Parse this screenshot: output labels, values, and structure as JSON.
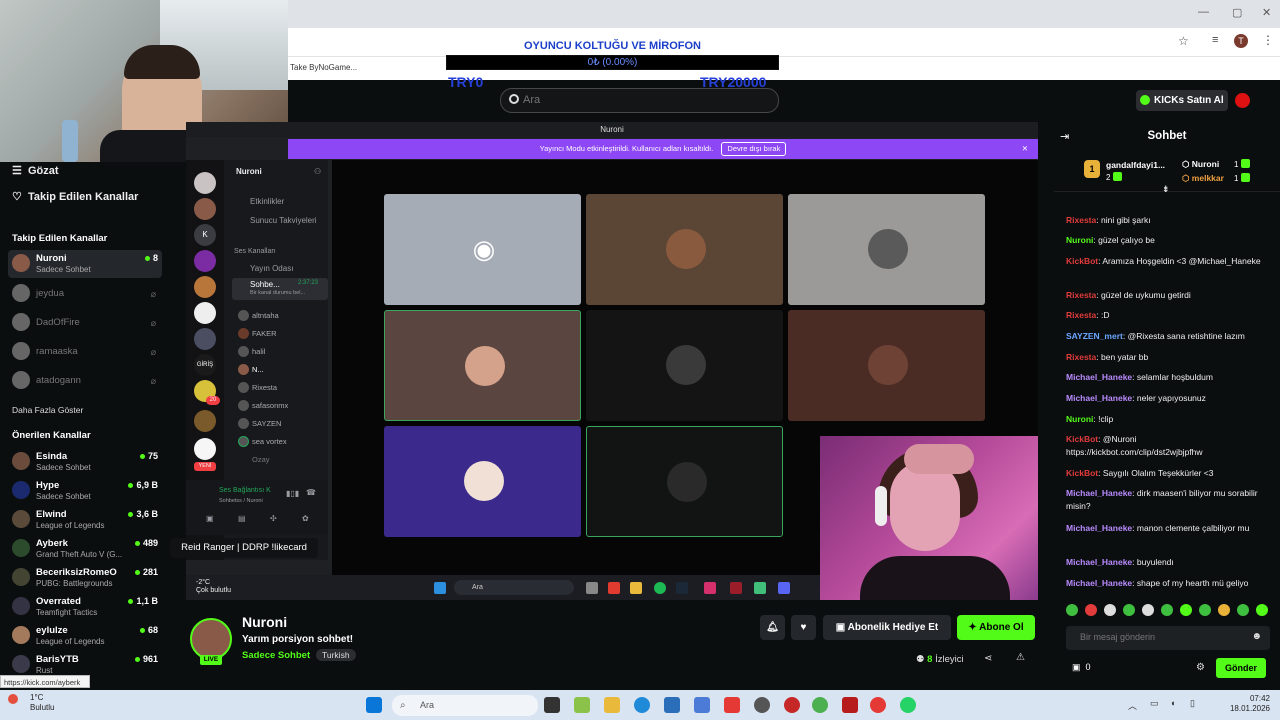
{
  "goal": {
    "title": "OYUNCU KOLTUĞU VE MİROFON",
    "progress_text": "0₺ (0.00%)",
    "progress_fraction": 0.0,
    "min_label": "TRY0",
    "max_label": "TRY20000"
  },
  "browser": {
    "bookmark": "Take ByNoGame...",
    "profile_initial": "T"
  },
  "header": {
    "search_placeholder": "Ara",
    "kicks_button": "KICKs Satın Al"
  },
  "sidebar": {
    "nav": [
      {
        "label": "Gözat"
      },
      {
        "label": "Takip Edilen Kanallar"
      }
    ],
    "followed_title": "Takip Edilen Kanallar",
    "followed": [
      {
        "name": "Nuroni",
        "category": "Sadece Sohbet",
        "count": "8",
        "live": true
      },
      {
        "name": "jeydua",
        "live": false
      },
      {
        "name": "DadOfFire",
        "live": false
      },
      {
        "name": "ramaaska",
        "live": false
      },
      {
        "name": "atadogann",
        "live": false
      }
    ],
    "show_more": "Daha Fazla Göster",
    "recommended_title": "Önerilen Kanallar",
    "recommended": [
      {
        "name": "Esinda",
        "category": "Sadece Sohbet",
        "count": "75"
      },
      {
        "name": "Hype",
        "category": "Sadece Sohbet",
        "count": "6,9 B"
      },
      {
        "name": "Elwind",
        "category": "League of Legends",
        "count": "3,6 B"
      },
      {
        "name": "Ayberk",
        "category": "Grand Theft Auto V (G...",
        "count": "489"
      },
      {
        "name": "BeceriksizRomeO",
        "category": "PUBG: Battlegrounds",
        "count": "281"
      },
      {
        "name": "Overrated",
        "category": "Teamfight Tactics",
        "count": "1,1 B"
      },
      {
        "name": "eylulze",
        "category": "League of Legends",
        "count": "68"
      },
      {
        "name": "BarisYTB",
        "category": "Rust",
        "count": "961"
      }
    ]
  },
  "discord": {
    "window_title": "Nuroni",
    "banner_text": "Yayıncı Modu etkinleştirildi. Kullanıcı adları kısaltıldı.",
    "banner_button": "Devre dışı bırak",
    "server_name": "Nuroni",
    "server_initial": "K",
    "server_giris": "GİRİŞ",
    "server_badge": "20",
    "server_new": "YENİ",
    "channel_items": [
      "Etkinlikler",
      "Sunucu Takviyeleri"
    ],
    "voice_category": "Ses Kanalları",
    "stream_room": "Yayın Odası",
    "active_channel": "Sohbe...",
    "active_time": "2:37:23",
    "active_sub": "Bir kanal durumu bel...",
    "voice_users": [
      "altntaha",
      "FAKER",
      "halil",
      "N...",
      "Rixesta",
      "safasonmx",
      "SAYZEN",
      "sea vortex",
      "Ozay"
    ],
    "voice_status": "Ses Bağlantısı K",
    "voice_sub": "Sohbetss / Nuroni",
    "tooltip": "Reid Ranger | DDRP !likecard",
    "taskbar_search": "Ara",
    "taskbar_weather": "-2°C",
    "taskbar_weather_sub": "Çok bulutlu"
  },
  "chat": {
    "title": "Sohbet",
    "pinned": [
      {
        "name": "gandalfdayi1...",
        "count": "2"
      },
      {
        "name": "Nuroni",
        "count": "1"
      },
      {
        "name": "melkkar",
        "count": "1"
      }
    ],
    "messages": [
      {
        "user": "Rixesta",
        "color": "#e23b3b",
        "text": "nini gibi şarkı"
      },
      {
        "user": "Nuroni",
        "color": "#53fc18",
        "text": "güzel çalıyo be"
      },
      {
        "user": "KickBot",
        "color": "#e23b3b",
        "text": "Aramıza Hoşgeldin <3 @Michael_Haneke"
      },
      {
        "user": "Rixesta",
        "color": "#e23b3b",
        "text": "güzel de uykumu getirdi"
      },
      {
        "user": "Rixesta",
        "color": "#e23b3b",
        "text": ":D"
      },
      {
        "user": "SAYZEN_mert",
        "color": "#6aa6ff",
        "text": "@Rixesta sana retishtine lazım"
      },
      {
        "user": "Rixesta",
        "color": "#e23b3b",
        "text": "ben yatar bb"
      },
      {
        "user": "Michael_Haneke",
        "color": "#b98bff",
        "text": "selamlar hoşbuldum"
      },
      {
        "user": "Michael_Haneke",
        "color": "#b98bff",
        "text": "neler yapıyosunuz"
      },
      {
        "user": "Nuroni",
        "color": "#53fc18",
        "text": "!clip"
      },
      {
        "user": "KickBot",
        "color": "#e23b3b",
        "text": "@Nuroni https://kickbot.com/clip/dst2wjbjpfhw"
      },
      {
        "user": "KickBot",
        "color": "#e23b3b",
        "text": "Saygılı Olalım Teşekkürler <3"
      },
      {
        "user": "Michael_Haneke",
        "color": "#b98bff",
        "text": "dirk maasen'i biliyor mu sorabilir misin?"
      },
      {
        "user": "Michael_Haneke",
        "color": "#b98bff",
        "text": "manon clemente çalbiliyor mu"
      },
      {
        "user": "Michael_Haneke",
        "color": "#b98bff",
        "text": "buyulendı"
      },
      {
        "user": "Michael_Haneke",
        "color": "#b98bff",
        "text": "shape of my hearth mü geliyo"
      }
    ],
    "input_placeholder": "Bir mesaj gönderin",
    "kicks_count": "0",
    "send_label": "Gönder"
  },
  "stream": {
    "name": "Nuroni",
    "title": "Yarım porsiyon sohbet!",
    "category": "Sadece Sohbet",
    "tag": "Turkish",
    "live_label": "LIVE",
    "gift_button": "Abonelik Hediye Et",
    "subscribe_button": "Abone Ol",
    "viewer_count": "8",
    "viewer_label": "İzleyici"
  },
  "taskbar": {
    "search_text": "Ara",
    "weather_temp": "1°C",
    "weather_desc": "Bulutlu",
    "time": "07:42",
    "date": "18.01.2026",
    "status_url": "https://kick.com/ayberk"
  },
  "colors": {
    "kick_green": "#53fc18",
    "discord_purple": "#8e47f5"
  }
}
